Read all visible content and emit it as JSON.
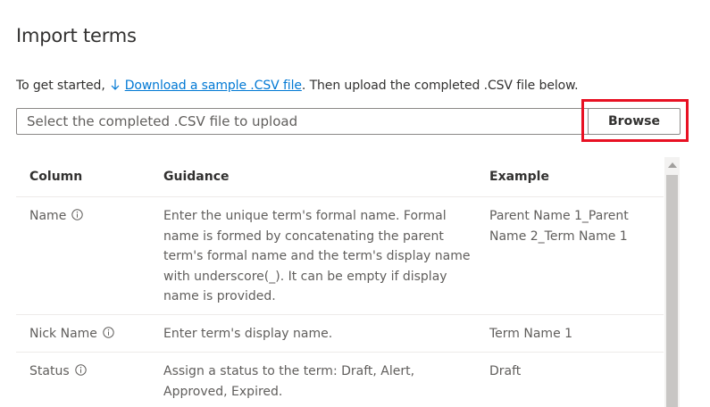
{
  "page": {
    "title": "Import terms",
    "intro_before": "To get started,",
    "download_link": "Download a sample .CSV file",
    "intro_after": ". Then upload the completed .CSV file below."
  },
  "upload": {
    "placeholder": "Select the completed .CSV file to upload",
    "browse_label": "Browse"
  },
  "colors": {
    "accent": "#0078d4",
    "highlight": "#e81123"
  },
  "table": {
    "headers": [
      "Column",
      "Guidance",
      "Example"
    ],
    "rows": [
      {
        "column": "Name",
        "guidance": "Enter the unique term's formal name. Formal name is formed by concatenating the parent term's formal name and the term's display name with underscore(_). It can be empty if display name is provided.",
        "example": "Parent Name 1_Parent Name 2_Term Name 1"
      },
      {
        "column": "Nick Name",
        "guidance": "Enter term's display name.",
        "example": "Term Name 1"
      },
      {
        "column": "Status",
        "guidance": "Assign a status to the term: Draft, Alert, Approved, Expired.",
        "example": "Draft"
      }
    ]
  }
}
